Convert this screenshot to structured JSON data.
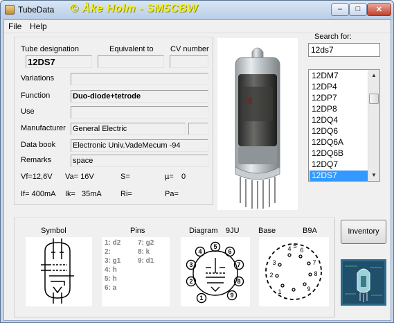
{
  "window": {
    "title": "TubeData",
    "credit": "© Åke Holm - SM5CBW",
    "min_glyph": "–",
    "max_glyph": "□",
    "close_glyph": "✕"
  },
  "menu": {
    "file": "File",
    "help": "Help"
  },
  "header_labels": {
    "designation": "Tube designation",
    "equivalent": "Equivalent to",
    "cv": "CV number"
  },
  "tube": {
    "designation": "12DS7",
    "equivalent": "",
    "cv": "",
    "variations": "",
    "function": "Duo-diode+tetrode",
    "use": "",
    "manufacturer": "General Electric",
    "manufacturer_extra": "",
    "databook": "Electronic Univ.VadeMecum -94",
    "remarks": "space"
  },
  "field_labels": {
    "variations": "Variations",
    "function": "Function",
    "use": "Use",
    "manufacturer": "Manufacturer",
    "databook": "Data book",
    "remarks": "Remarks"
  },
  "params": {
    "vf": "Vf=12,6V",
    "va": "Va= 16V",
    "s": "S=",
    "mu": "µ=",
    "mu_val": "0",
    "if": "If= 400mA",
    "ik": "Ik=",
    "ik_val": "35mA",
    "ri": "Ri=",
    "pa": "Pa="
  },
  "search": {
    "label": "Search for:",
    "value": "12ds7"
  },
  "list": {
    "items": [
      "12DM7",
      "12DP4",
      "12DP7",
      "12DP8",
      "12DQ4",
      "12DQ6",
      "12DQ6A",
      "12DQ6B",
      "12DQ7",
      "12DS7"
    ],
    "selected": "12DS7"
  },
  "bottom": {
    "symbol_label": "Symbol",
    "pins_label": "Pins",
    "diagram_label": "Diagram",
    "diagram_code": "9JU",
    "base_label": "Base",
    "base_code": "B9A",
    "pins": [
      "1: d2",
      "2:",
      "3: g1",
      "4: h",
      "5: h",
      "6: a",
      "7: g2",
      "8: k",
      "9: d1"
    ]
  },
  "buttons": {
    "inventory": "Inventory"
  },
  "colors": {
    "accent": "#3399ff",
    "credit": "#f3ee21",
    "window_frame": "#c5d6ea"
  }
}
